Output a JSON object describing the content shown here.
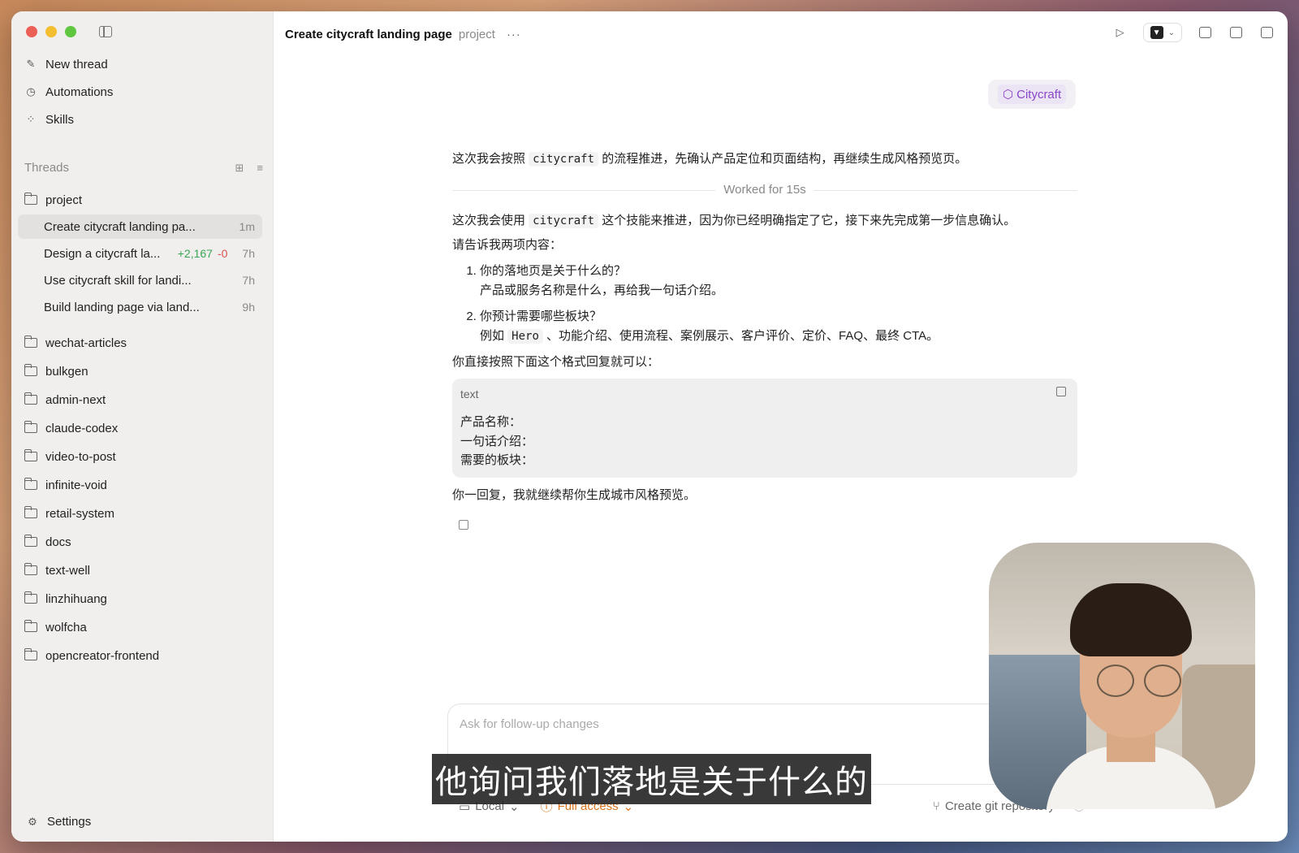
{
  "sidebar": {
    "nav": [
      {
        "label": "New thread",
        "icon": "edit-icon"
      },
      {
        "label": "Automations",
        "icon": "clock-icon"
      },
      {
        "label": "Skills",
        "icon": "grid-icon"
      }
    ],
    "threads_label": "Threads",
    "active_project": "project",
    "threads": [
      {
        "title": "Create citycraft landing pa...",
        "time": "1m",
        "add": "",
        "del": ""
      },
      {
        "title": "Design a citycraft la...",
        "time": "7h",
        "add": "+2,167",
        "del": "-0"
      },
      {
        "title": "Use citycraft skill for landi...",
        "time": "7h",
        "add": "",
        "del": ""
      },
      {
        "title": "Build landing page via land...",
        "time": "9h",
        "add": "",
        "del": ""
      }
    ],
    "folders": [
      "wechat-articles",
      "bulkgen",
      "admin-next",
      "claude-codex",
      "video-to-post",
      "infinite-void",
      "retail-system",
      "docs",
      "text-well",
      "linzhihuang",
      "wolfcha",
      "opencreator-frontend"
    ],
    "settings_label": "Settings"
  },
  "header": {
    "title": "Create citycraft landing page",
    "project": "project",
    "more": "···"
  },
  "chip": {
    "label": "Citycraft",
    "color": "#8a46c8"
  },
  "message": {
    "intro_pre": "这次我会按照 ",
    "intro_code": "citycraft",
    "intro_post": " 的流程推进，先确认产品定位和页面结构，再继续生成风格预览页。",
    "worked": "Worked for 15s",
    "p1_pre": "这次我会使用 ",
    "p1_code": "citycraft",
    "p1_post": " 这个技能来推进，因为你已经明确指定了它，接下来先完成第一步信息确认。",
    "p2": "请告诉我两项内容：",
    "list": [
      {
        "head": "你的落地页是关于什么的？",
        "sub_pre": "产品或服务名称是什么，再给我一句话介绍。",
        "sub_code": "",
        "sub_post": ""
      },
      {
        "head": "你预计需要哪些板块？",
        "sub_pre": "例如 ",
        "sub_code": "Hero",
        "sub_post": " 、功能介绍、使用流程、案例展示、客户评价、定价、FAQ、最终 CTA。"
      }
    ],
    "p3": "你直接按照下面这个格式回复就可以：",
    "code_lang": "text",
    "code_lines": [
      "产品名称：",
      "一句话介绍：",
      "需要的板块："
    ],
    "p4": "你一回复，我就继续帮你生成城市风格预览。"
  },
  "composer": {
    "placeholder": "Ask for follow-up changes"
  },
  "bottom": {
    "local": "Local",
    "access": "Full access",
    "access_color": "#d9731c",
    "git": "Create git repository"
  },
  "subtitle": "他询问我们落地是关于什么的"
}
